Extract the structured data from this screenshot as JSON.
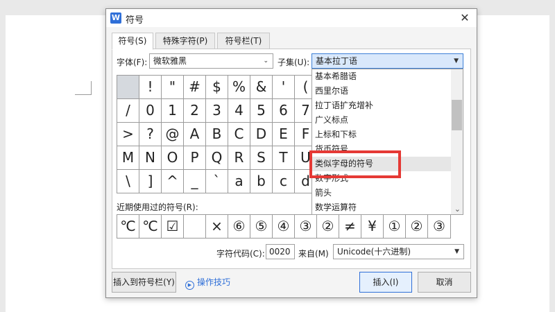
{
  "dialog": {
    "title": "符号",
    "close_label": "✕",
    "app_icon_letter": "W"
  },
  "tabs": [
    {
      "label": "符号(S)",
      "active": true
    },
    {
      "label": "特殊字符(P)",
      "active": false
    },
    {
      "label": "符号栏(T)",
      "active": false
    }
  ],
  "font": {
    "label": "字体(F):",
    "value": "微软雅黑"
  },
  "subset": {
    "label": "子集(U):",
    "value": "基本拉丁语"
  },
  "symbol_grid": [
    [
      "",
      "!",
      "\"",
      "#",
      "$",
      "%",
      "&",
      "'",
      "("
    ],
    [
      "/",
      "0",
      "1",
      "2",
      "3",
      "4",
      "5",
      "6",
      "7"
    ],
    [
      ">",
      "?",
      "@",
      "A",
      "B",
      "C",
      "D",
      "E",
      "F"
    ],
    [
      "M",
      "N",
      "O",
      "P",
      "Q",
      "R",
      "S",
      "T",
      "U"
    ],
    [
      "\\",
      "]",
      "^",
      "_",
      "`",
      "a",
      "b",
      "c",
      "d"
    ]
  ],
  "subset_options": [
    "基本希腊语",
    "西里尔语",
    "拉丁语扩充增补",
    "广义标点",
    "上标和下标",
    "货币符号",
    "类似字母的符号",
    "数字形式",
    "箭头",
    "数学运算符"
  ],
  "hovered_option": "类似字母的符号",
  "recent": {
    "label": "近期使用过的符号(R):",
    "symbols": [
      "℃",
      "℃",
      "☑",
      "",
      "×",
      "⑥",
      "⑤",
      "④",
      "③",
      "②",
      "≠",
      "¥",
      "①",
      "②",
      "③"
    ]
  },
  "char_code": {
    "label": "字符代码(C):",
    "value": "0020",
    "from_label": "来自(M)",
    "from_value": "Unicode(十六进制)"
  },
  "buttons": {
    "insert_to_bar": "插入到符号栏(Y)",
    "tips": "操作技巧",
    "insert": "插入(I)",
    "cancel": "取消"
  },
  "colors": {
    "accent": "#2f6fd8",
    "highlight": "#e53935"
  }
}
